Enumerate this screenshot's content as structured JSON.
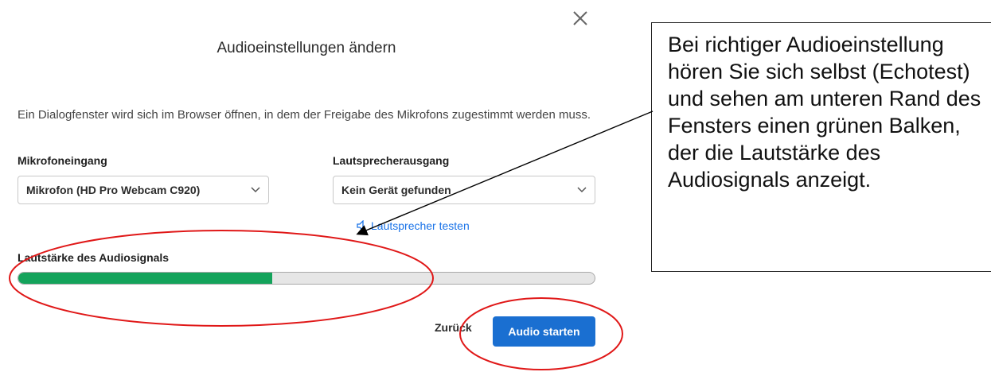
{
  "dialog": {
    "title": "Audioeinstellungen ändern",
    "info_text": "Ein Dialogfenster wird sich im Browser öffnen, in dem der Freigabe des Mikrofons zugestimmt werden muss.",
    "microphone": {
      "label": "Mikrofoneingang",
      "selected": "Mikrofon (HD Pro Webcam C920)"
    },
    "speaker": {
      "label": "Lautsprecherausgang",
      "selected": "Kein Gerät gefunden"
    },
    "test_speaker_link": "Lautsprecher testen",
    "audio_level": {
      "label": "Lautstärke des Audiosignals",
      "fraction": 0.44
    },
    "back_label": "Zurück",
    "start_label": "Audio starten"
  },
  "annotation": {
    "callout_text": "Bei richtiger Audioeinstellung hören Sie sich selbst (Echotest) und sehen am unteren Rand des Fensters einen grünen Balken, der die Lautstärke des Audiosignals anzeigt."
  },
  "colors": {
    "accent": "#1a6fd1",
    "level_fill": "#14a35b",
    "annotation_red": "#e01818"
  }
}
